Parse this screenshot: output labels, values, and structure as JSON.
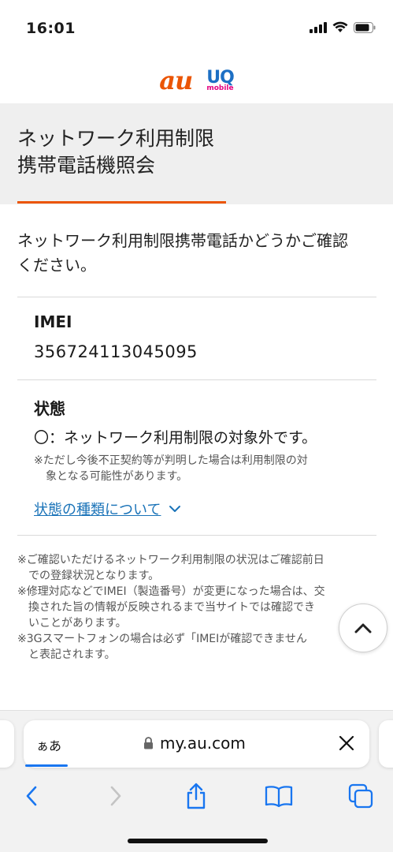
{
  "status_bar": {
    "time": "16:01"
  },
  "brand": {
    "logo_au": "au",
    "logo_uq": "UQ",
    "logo_uq_sub": "mobile"
  },
  "page": {
    "title_line1": "ネットワーク利用制限",
    "title_line2": "携帯電話機照会",
    "intro_line1": "ネットワーク利用制限携帯電話かどうかご確認",
    "intro_line2": "ください。"
  },
  "imei": {
    "label": "IMEI",
    "value": "356724113045095"
  },
  "state": {
    "label": "状態",
    "value": "〇：ネットワーク利用制限の対象外です。",
    "note_line1": "※ただし今後不正契約等が判明した場合は利用制限の対",
    "note_line2": "象となる可能性があります。",
    "link": "状態の種類について"
  },
  "notes": {
    "n1_line1": "※ご確認いただけるネットワーク利用制限の状況はご確認前日",
    "n1_line2": "での登録状況となります。",
    "n2_line1": "※修理対応などでIMEI（製造番号）が変更になった場合は、交",
    "n2_line2": "換された旨の情報が反映されるまで当サイトでは確認でき",
    "n2_line3": "いことがあります。",
    "n3_line1": "※3Gスマートフォンの場合は必ず「IMEIが確認できません",
    "n3_line2": "と表記されます。"
  },
  "browser": {
    "aa_label": "ぁあ",
    "url": "my.au.com"
  },
  "colors": {
    "accent": "#eb5505",
    "link": "#1a73b8",
    "browser_blue": "#1976f0"
  }
}
